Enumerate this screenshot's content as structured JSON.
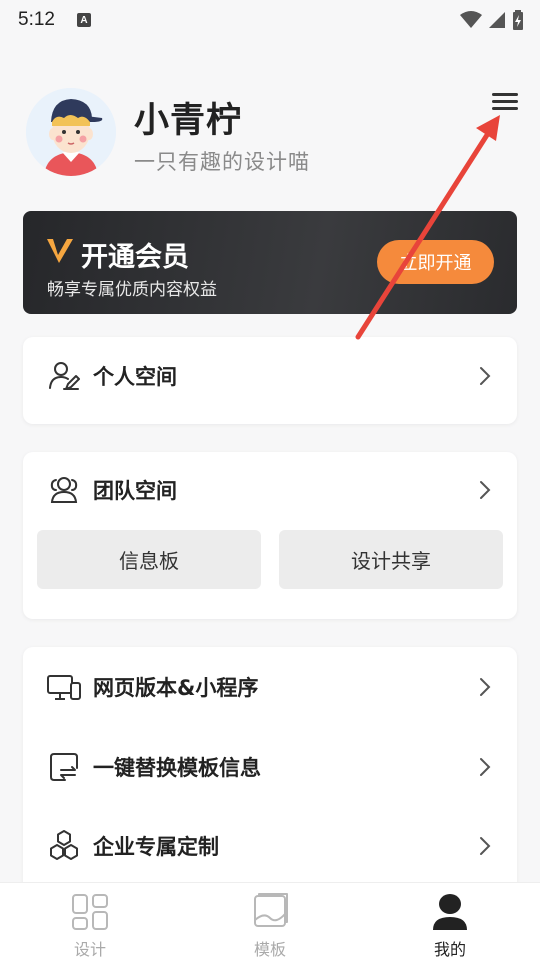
{
  "status_bar": {
    "time": "5:12",
    "notification_glyph": "A"
  },
  "profile": {
    "name": "小青柠",
    "slogan": "一只有趣的设计喵"
  },
  "vip": {
    "logo_glyph": "V",
    "title": "开通会员",
    "description": "畅享专属优质内容权益",
    "button_label": "立即开通",
    "button_color": "#f58a3c"
  },
  "personal_space": {
    "label": "个人空间"
  },
  "team_space": {
    "label": "团队空间",
    "buttons": [
      "信息板",
      "设计共享"
    ]
  },
  "menu_list": [
    {
      "label": "网页版本&小程序",
      "icon": "monitor-phone-icon"
    },
    {
      "label": "一键替换模板信息",
      "icon": "replace-icon"
    },
    {
      "label": "企业专属定制",
      "icon": "hexagons-icon"
    }
  ],
  "tabbar": [
    {
      "label": "设计",
      "icon": "grid-icon",
      "active": false
    },
    {
      "label": "模板",
      "icon": "template-icon",
      "active": false
    },
    {
      "label": "我的",
      "icon": "user-icon",
      "active": true
    }
  ],
  "annotation": {
    "arrow_color": "#e8443a"
  }
}
